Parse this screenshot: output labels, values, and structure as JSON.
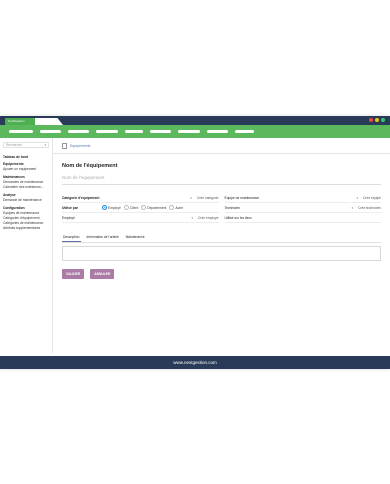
{
  "window": {
    "tab_label": "NextGestion",
    "dots": [
      "#e74c3c",
      "#f1c40f",
      "#2ecc71"
    ],
    "menu_pills": [
      24,
      21,
      21,
      22,
      18,
      21,
      22,
      21,
      19
    ]
  },
  "sidebar": {
    "search_placeholder": "Recherche",
    "sections": [
      {
        "title": "Tableau de bord",
        "items": []
      },
      {
        "title": "Equipements",
        "items": [
          "Ajouter un equipement"
        ]
      },
      {
        "title": "Maintenances",
        "items": [
          "Demandes de maintenance",
          "Calendrier des maintenan..."
        ]
      },
      {
        "title": "Analyse",
        "items": [
          "Demande de maintenance"
        ]
      },
      {
        "title": "Configuration",
        "items": [
          "Equipes de maintenance",
          "Catégories d'équipement",
          "Catégories de maintenance",
          "Attributs supplementaires"
        ]
      }
    ]
  },
  "breadcrumb": {
    "label": "Equipements"
  },
  "form": {
    "title": "Nom de l'équipement",
    "name_placeholder": "Nom de l'équipement",
    "left": {
      "category_label": "Catégorie d'équipement",
      "category_link": "Crée catégorie",
      "used_by_label": "Utilisé par",
      "used_by_options": [
        "Employé",
        "Client",
        "Département",
        "Autre"
      ],
      "used_by_selected": 0,
      "employee_label": "Employé",
      "employee_link": "Crée employé"
    },
    "right": {
      "team_label": "Équipe de maintenance",
      "team_link": "Crée équipe",
      "technician_label": "Technicien",
      "technician_link": "Crée technicien",
      "location_label": "Utilisé sur les lieux"
    },
    "tabs": [
      "Description",
      "Information de l'article",
      "Maintenance"
    ],
    "buttons": {
      "save": "VALIDER",
      "cancel": "ANNULER"
    }
  },
  "footer": {
    "text": "www.nextgestion.com"
  }
}
